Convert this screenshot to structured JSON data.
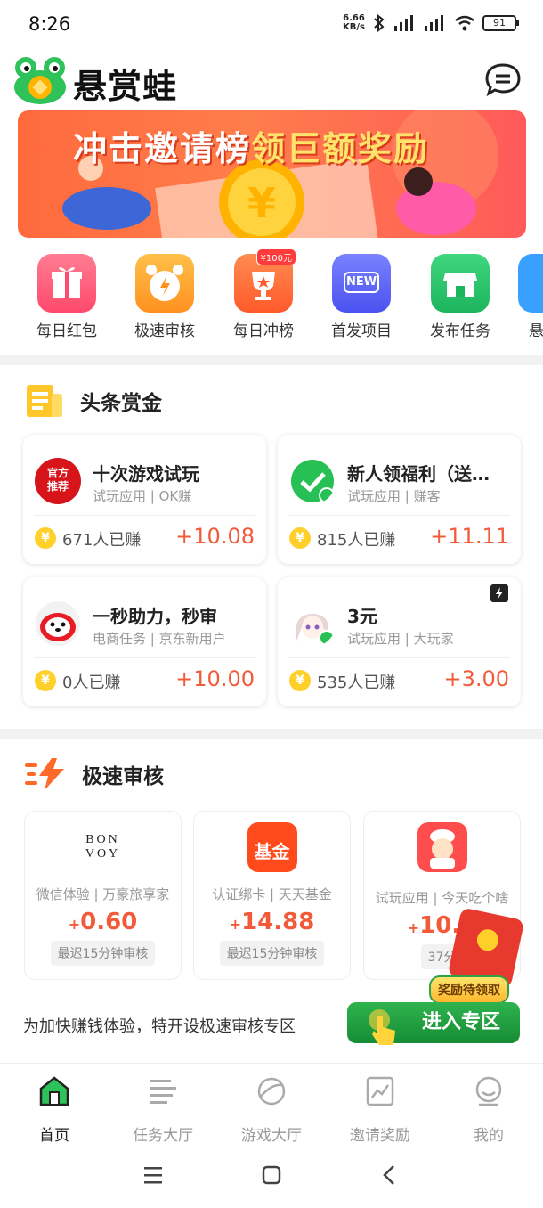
{
  "status": {
    "time": "8:26",
    "net_speed_value": "6.66",
    "net_speed_unit": "KB/s",
    "battery": "91"
  },
  "header": {
    "app_name": "悬赏蛙"
  },
  "banner": {
    "title_part1": "冲击邀请榜",
    "title_part2": "领巨额奖励",
    "symbol": "¥"
  },
  "quick_nav": [
    {
      "label": "每日红包",
      "color": "#ff5f7a"
    },
    {
      "label": "极速审核",
      "color": "#ffa12e",
      "badge": ""
    },
    {
      "label": "每日冲榜",
      "color": "#ff6d3a",
      "badge": "¥100元"
    },
    {
      "label": "首发项目",
      "color": "#5b63ff",
      "badge_text": "NEW"
    },
    {
      "label": "发布任务",
      "color": "#26c46b"
    },
    {
      "label": "悬",
      "color": "#3aa0ff"
    }
  ],
  "headline": {
    "title": "头条赏金",
    "cards": [
      {
        "title": "十次游戏试玩",
        "tag1": "试玩应用",
        "tag2": "OK赚",
        "count": "671人已赚",
        "reward": "+10.08",
        "avatar_text1": "官方",
        "avatar_text2": "推荐"
      },
      {
        "title": "新人领福利（送…",
        "tag1": "试玩应用",
        "tag2": "赚客",
        "count": "815人已赚",
        "reward": "+11.11"
      },
      {
        "title": "一秒助力，秒审",
        "tag1": "电商任务",
        "tag2": "京东新用户",
        "count": "0人已赚",
        "reward": "+10.00"
      },
      {
        "title": "3元",
        "tag1": "试玩应用",
        "tag2": "大玩家",
        "count": "535人已赚",
        "reward": "+3.00"
      }
    ],
    "coin_symbol": "¥"
  },
  "fast_review": {
    "title": "极速审核",
    "cards": [
      {
        "logo_text1": "BON",
        "logo_text2": "VOY",
        "tag1": "微信体验",
        "tag2": "万豪旅享家",
        "reward": "0.60",
        "note": "最迟15分钟审核"
      },
      {
        "logo_text1": "基金",
        "tag1": "认证绑卡",
        "tag2": "天天基金",
        "reward": "14.88",
        "note": "最迟15分钟审核"
      },
      {
        "tag1": "试玩应用",
        "tag2": "今天吃个啥",
        "reward": "10.0",
        "note": "37分"
      }
    ],
    "plus": "+",
    "promo_text": "为加快赚钱体验，特开设极速审核专区",
    "enter_label": "进入专区",
    "reward_pending": "奖励待领取"
  },
  "bottom_nav": [
    {
      "label": "首页",
      "active": true
    },
    {
      "label": "任务大厅"
    },
    {
      "label": "游戏大厅"
    },
    {
      "label": "邀请奖励"
    },
    {
      "label": "我的"
    }
  ]
}
